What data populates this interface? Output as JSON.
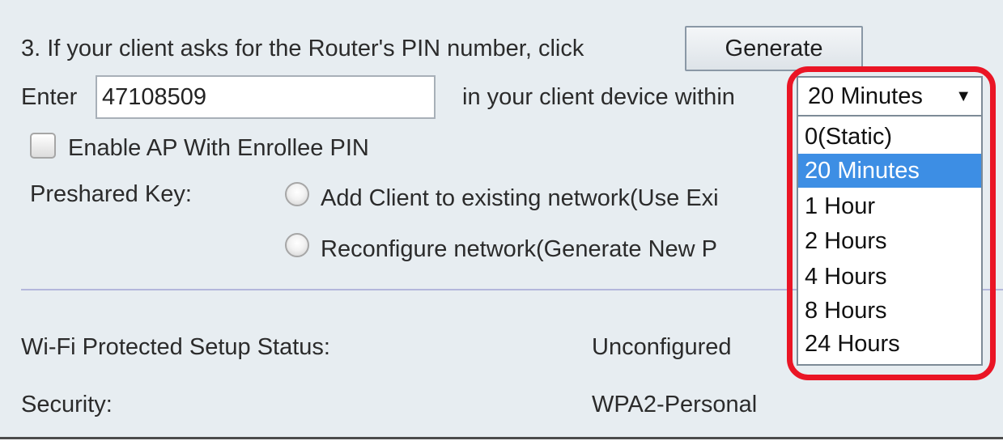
{
  "step": {
    "instruction": "3. If your client asks for the Router's PIN number, click",
    "generate_label": "Generate",
    "enter_label": "Enter",
    "pin_value": "47108509",
    "within_label": "in your client device within"
  },
  "enable_ap": {
    "label": "Enable AP With Enrollee PIN",
    "checked": false
  },
  "preshared_key": {
    "label": "Preshared Key:",
    "options": [
      {
        "label": "Add Client to existing network(Use Exi",
        "checked": false
      },
      {
        "label": "Reconfigure network(Generate New P",
        "checked": false
      }
    ]
  },
  "timeout_select": {
    "selected": "20 Minutes",
    "arrow": "▼",
    "options": [
      "0(Static)",
      "20 Minutes",
      "1 Hour",
      "2 Hours",
      "4 Hours",
      "8 Hours",
      "24 Hours"
    ]
  },
  "status": {
    "wps_label": "Wi-Fi Protected Setup Status:",
    "wps_value": "Unconfigured",
    "security_label": "Security:",
    "security_value": "WPA2-Personal"
  },
  "colors": {
    "highlight": "#ea1525",
    "selected_option": "#3d8ee4",
    "panel_background": "#e7edf1"
  }
}
